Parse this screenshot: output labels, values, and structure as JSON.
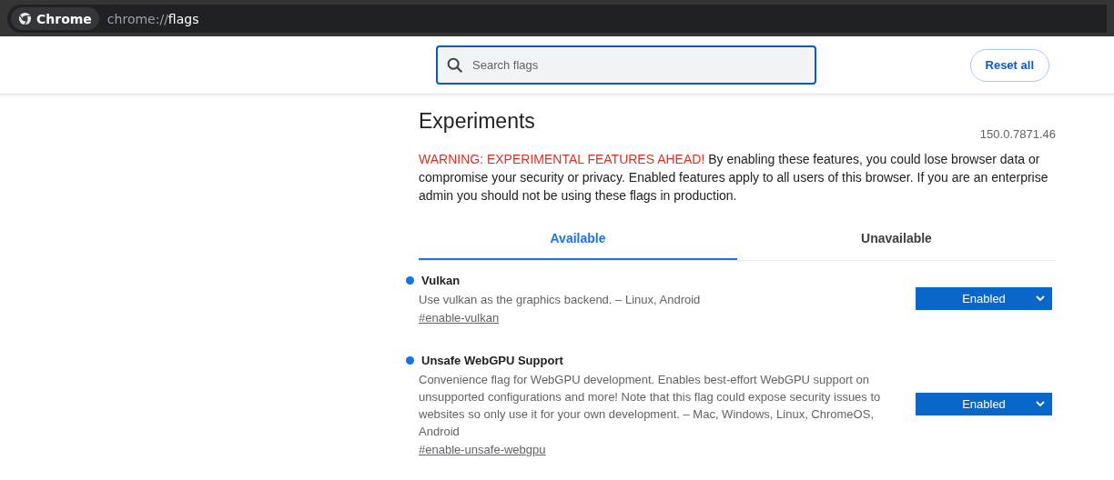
{
  "browser": {
    "chip": "Chrome",
    "address": {
      "scheme": "chrome://",
      "path": "flags"
    }
  },
  "search": {
    "placeholder": "Search flags"
  },
  "reset_button": "Reset all",
  "title": "Experiments",
  "version": "150.0.7871.46",
  "warning": {
    "label": "WARNING: EXPERIMENTAL FEATURES AHEAD!",
    "text": "By enabling these features, you could lose browser data or compromise your security or privacy. Enabled features apply to all users of this browser. If you are an enterprise admin you should not be using these flags in production."
  },
  "tabs": [
    {
      "label": "Available",
      "selected": true
    },
    {
      "label": "Unavailable",
      "selected": false
    }
  ],
  "flags": [
    {
      "name": "Vulkan",
      "modified": true,
      "description": "Use vulkan as the graphics backend. – Linux, Android",
      "link": "#enable-vulkan",
      "value": "Enabled"
    },
    {
      "name": "Unsafe WebGPU Support",
      "modified": true,
      "description": "Convenience flag for WebGPU development. Enables best-effort WebGPU support on unsupported configurations and more! Note that this flag could expose security issues to websites so only use it for your own development. – Mac, Windows, Linux, ChromeOS, Android",
      "link": "#enable-unsafe-webgpu",
      "value": "Enabled"
    }
  ]
}
